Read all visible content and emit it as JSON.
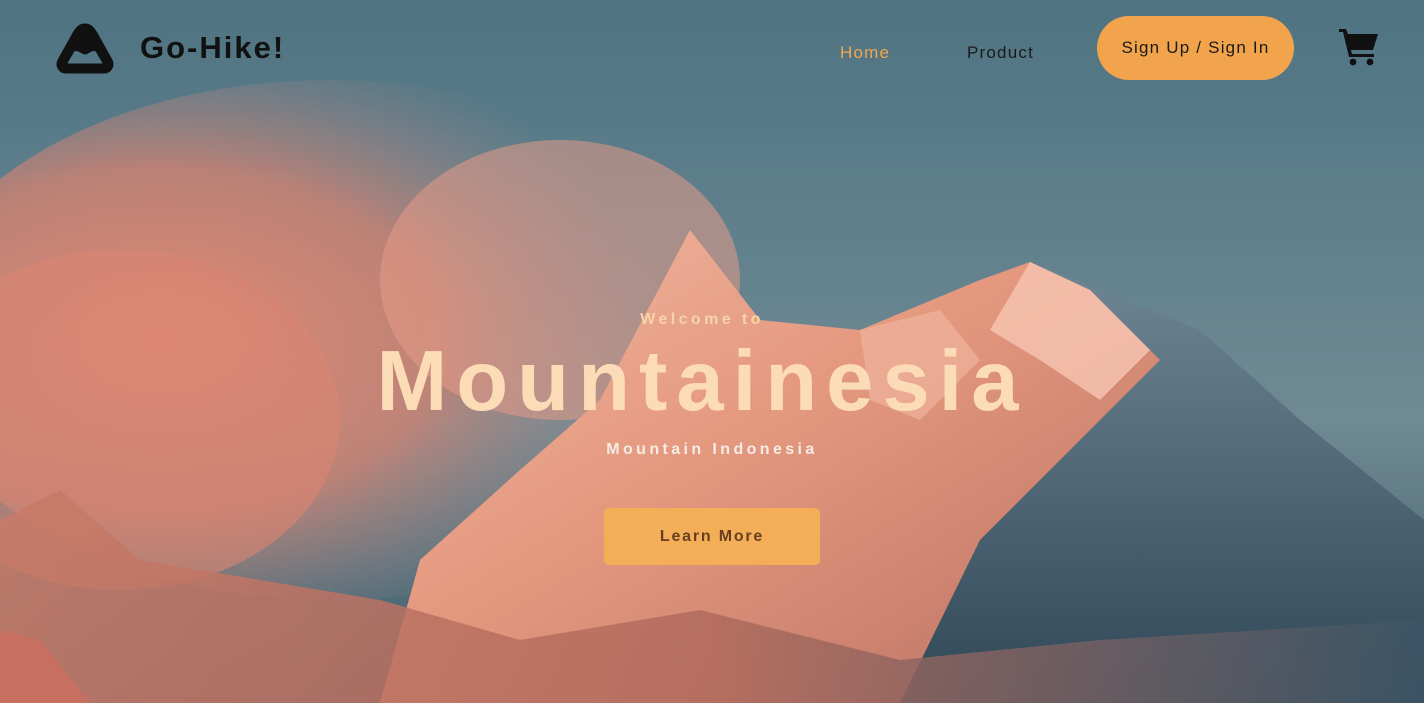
{
  "navbar": {
    "brand": "Go-Hike!",
    "logo_icon": "triangle-logo-icon",
    "links": [
      {
        "label": "Home",
        "active": true
      },
      {
        "label": "Product",
        "active": false
      }
    ],
    "signup_label": "Sign Up / Sign In",
    "cart_icon": "shopping-cart-icon"
  },
  "hero": {
    "welcome": "Welcome to",
    "headline": "Mountainesia",
    "subline": "Mountain Indonesia",
    "cta_label": "Learn More"
  },
  "colors": {
    "accent": "#f2a44d",
    "active_link": "#f3a64e",
    "headline": "#fbdcb6",
    "sky": "#5a7c8a",
    "alpenglow": "#e88a6c"
  }
}
